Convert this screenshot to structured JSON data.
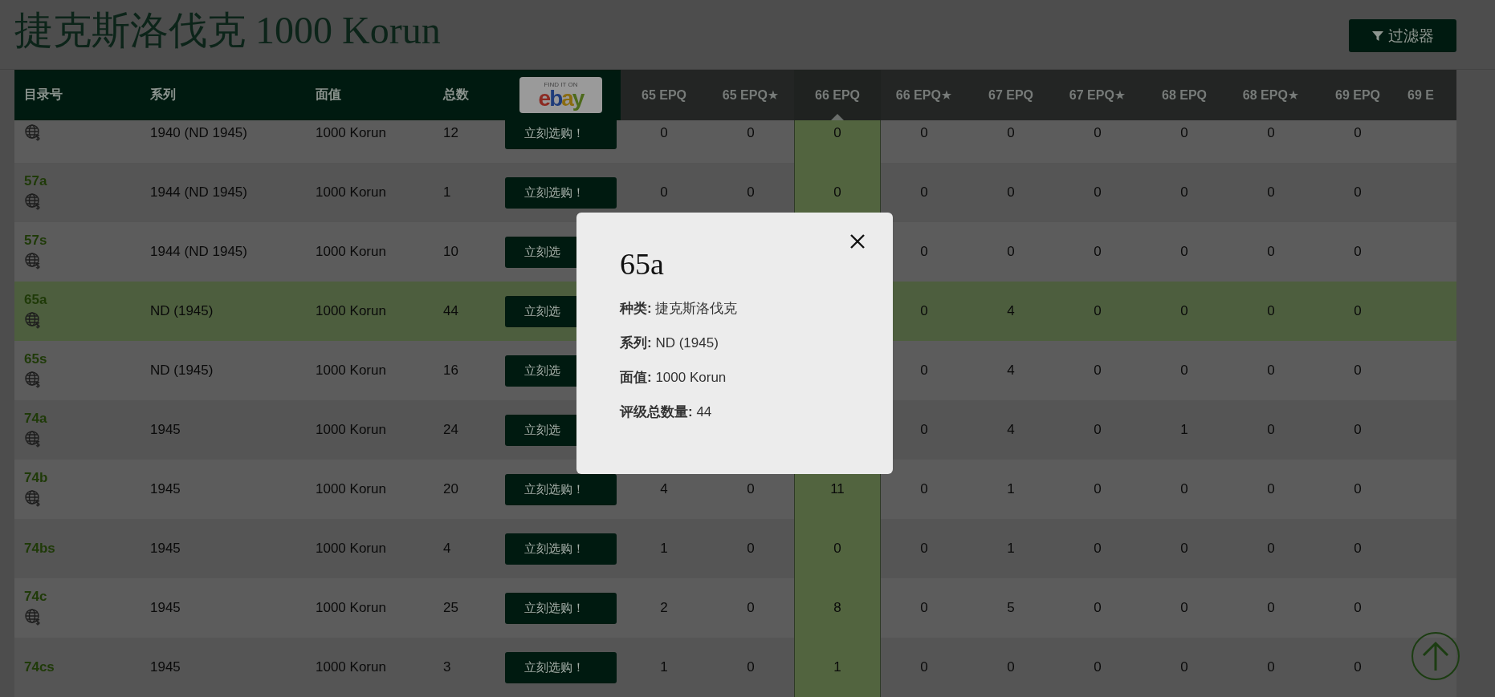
{
  "title": "捷克斯洛伐克 1000 Korun",
  "filter_button": {
    "label": "过滤器"
  },
  "table": {
    "columns": [
      "目录号",
      "系列",
      "面值",
      "总数"
    ],
    "ebay_badge": {
      "caption": "FIND IT ON",
      "logo": "ebay"
    },
    "grade_columns": [
      {
        "label": "65 EPQ",
        "selected": false
      },
      {
        "label": "65 EPQ★",
        "selected": false
      },
      {
        "label": "66 EPQ",
        "selected": true
      },
      {
        "label": "66 EPQ★",
        "selected": false
      },
      {
        "label": "67 EPQ",
        "selected": false
      },
      {
        "label": "67 EPQ★",
        "selected": false
      },
      {
        "label": "68 EPQ",
        "selected": false
      },
      {
        "label": "68 EPQ★",
        "selected": false
      },
      {
        "label": "69 EPQ",
        "selected": false
      },
      {
        "label": "69 E",
        "selected": false
      }
    ],
    "rows": [
      {
        "globe": true,
        "series": "1940 (ND 1945)",
        "denomination": "1000 Korun",
        "total": "12",
        "buy": "立刻选购！",
        "selected": false,
        "grades": [
          "0",
          "0",
          "0",
          "0",
          "0",
          "0",
          "0",
          "0",
          "0"
        ]
      },
      {
        "catalog": "57a",
        "globe": true,
        "series": "1944 (ND 1945)",
        "denomination": "1000 Korun",
        "total": "1",
        "buy": "立刻选购！",
        "selected": false,
        "grades": [
          "0",
          "0",
          "0",
          "0",
          "0",
          "0",
          "0",
          "0",
          "0"
        ]
      },
      {
        "catalog": "57s",
        "globe": true,
        "series": "1944 (ND 1945)",
        "denomination": "1000 Korun",
        "total": "10",
        "buy": "立刻选",
        "selected": false,
        "grades": [
          "0",
          "0",
          "0",
          "0",
          "0",
          "0"
        ]
      },
      {
        "catalog": "65a",
        "globe": true,
        "series": "ND (1945)",
        "denomination": "1000 Korun",
        "total": "44",
        "buy": "立刻选",
        "selected": true,
        "grades": [
          "0",
          "4",
          "0",
          "0",
          "0",
          "0"
        ]
      },
      {
        "catalog": "65s",
        "globe": true,
        "series": "ND (1945)",
        "denomination": "1000 Korun",
        "total": "16",
        "buy": "立刻选",
        "selected": false,
        "grades": [
          "0",
          "4",
          "0",
          "0",
          "0",
          "0"
        ]
      },
      {
        "catalog": "74a",
        "globe": true,
        "series": "1945",
        "denomination": "1000 Korun",
        "total": "24",
        "buy": "立刻选",
        "selected": false,
        "grades": [
          "0",
          "4",
          "0",
          "1",
          "0",
          "0"
        ]
      },
      {
        "catalog": "74b",
        "globe": true,
        "series": "1945",
        "denomination": "1000 Korun",
        "total": "20",
        "buy": "立刻选购！",
        "selected": false,
        "grades": [
          "4",
          "0",
          "11",
          "0",
          "1",
          "0",
          "0",
          "0",
          "0"
        ]
      },
      {
        "catalog": "74bs",
        "globe": false,
        "series": "1945",
        "denomination": "1000 Korun",
        "total": "4",
        "buy": "立刻选购！",
        "selected": false,
        "grades": [
          "1",
          "0",
          "0",
          "0",
          "1",
          "0",
          "0",
          "0",
          "0"
        ]
      },
      {
        "catalog": "74c",
        "globe": true,
        "series": "1945",
        "denomination": "1000 Korun",
        "total": "25",
        "buy": "立刻选购！",
        "selected": false,
        "grades": [
          "2",
          "0",
          "8",
          "0",
          "5",
          "0",
          "0",
          "0",
          "0"
        ]
      },
      {
        "catalog": "74cs",
        "globe": false,
        "series": "1945",
        "denomination": "1000 Korun",
        "total": "3",
        "buy": "立刻选购！",
        "selected": false,
        "grades": [
          "1",
          "0",
          "1",
          "0",
          "0",
          "0",
          "0",
          "0",
          "0"
        ]
      }
    ]
  },
  "modal": {
    "title": "65a",
    "lines": [
      "**种类:** 捷克斯洛伐克",
      "**系列:** ND (1945)",
      "**面值:** 1000 Korun",
      "**评级总数量:** 44"
    ]
  }
}
